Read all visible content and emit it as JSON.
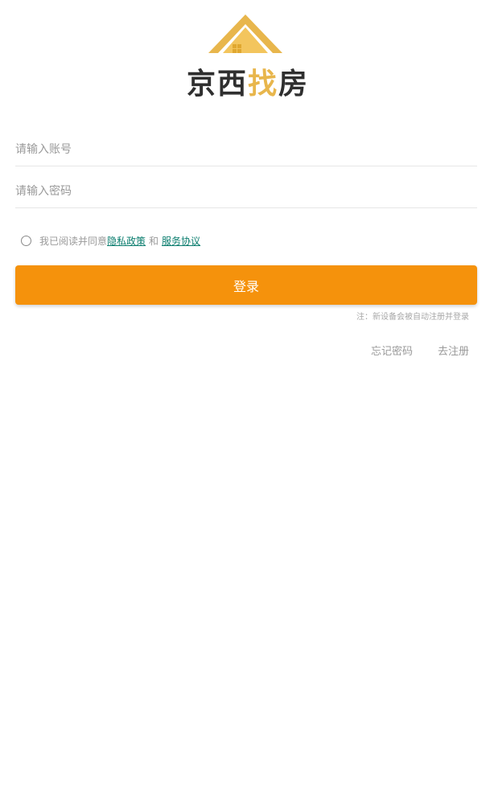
{
  "app": {
    "brand_name_part1": "京西",
    "brand_name_accent": "找",
    "brand_name_part2": "房",
    "logo_icon": "house-roof-icon",
    "brand_color": "#e8b64c",
    "accent_color": "#f5920c",
    "link_color": "#0a7d6e"
  },
  "form": {
    "account_placeholder": "请输入账号",
    "account_value": "",
    "password_placeholder": "请输入密码",
    "password_value": ""
  },
  "agreement": {
    "checked": false,
    "prefix": "我已阅读并同意",
    "privacy_link": "隐私政策",
    "joiner": "和",
    "terms_link": "服务协议"
  },
  "actions": {
    "login_label": "登录",
    "note": "注：新设备会被自动注册并登录",
    "forgot_password": "忘记密码",
    "register": "去注册"
  }
}
